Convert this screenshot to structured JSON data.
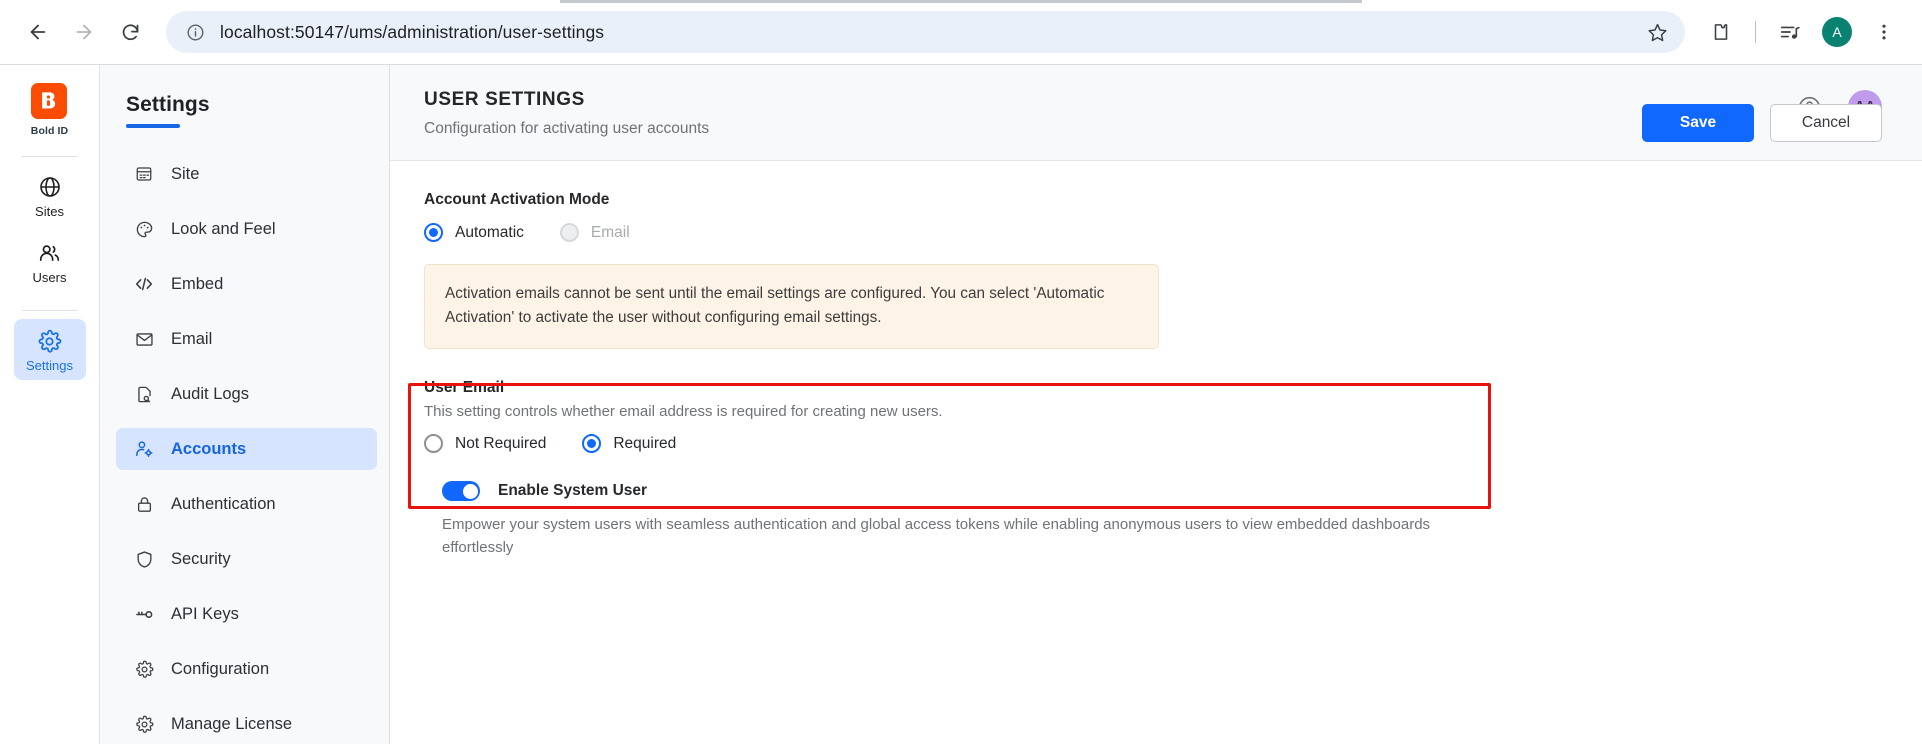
{
  "browser": {
    "url": "localhost:50147/ums/administration/user-settings",
    "back_label": "Back",
    "forward_label": "Forward",
    "reload_label": "Reload",
    "site_info_label": "View site information",
    "bookmark_label": "Bookmark this tab",
    "extensions_label": "Extensions",
    "media_label": "Media control",
    "profile_initial": "A",
    "menu_label": "Customize and control Chrome"
  },
  "rail": {
    "brand_label": "Bold ID",
    "items": [
      {
        "label": "Sites",
        "icon": "globe-icon",
        "active": false
      },
      {
        "label": "Users",
        "icon": "people-icon",
        "active": false
      },
      {
        "label": "Settings",
        "icon": "gear-icon",
        "active": true
      }
    ]
  },
  "nav": {
    "title": "Settings",
    "items": [
      {
        "label": "Site",
        "icon": "site-icon"
      },
      {
        "label": "Look and Feel",
        "icon": "palette-icon"
      },
      {
        "label": "Embed",
        "icon": "code-icon"
      },
      {
        "label": "Email",
        "icon": "envelope-icon"
      },
      {
        "label": "Audit Logs",
        "icon": "document-search-icon"
      },
      {
        "label": "Accounts",
        "icon": "user-gear-icon"
      },
      {
        "label": "Authentication",
        "icon": "lock-icon"
      },
      {
        "label": "Security",
        "icon": "shield-icon"
      },
      {
        "label": "API Keys",
        "icon": "key-icon"
      },
      {
        "label": "Configuration",
        "icon": "gear-icon"
      },
      {
        "label": "Manage License",
        "icon": "gear-icon"
      }
    ],
    "active_index": 5
  },
  "header": {
    "title": "USER SETTINGS",
    "subtitle": "Configuration for activating user accounts",
    "help_label": "Help",
    "avatar_initials": "AA",
    "save_label": "Save",
    "cancel_label": "Cancel"
  },
  "form": {
    "activation": {
      "label": "Account Activation Mode",
      "options": [
        {
          "label": "Automatic",
          "checked": true,
          "disabled": false
        },
        {
          "label": "Email",
          "checked": false,
          "disabled": true
        }
      ]
    },
    "warning": "Activation emails cannot be sent until the email settings are configured. You can select 'Automatic Activation' to activate the user without configuring email settings.",
    "user_email": {
      "label": "User Email",
      "description": "This setting controls whether email address is required for creating new users.",
      "options": [
        {
          "label": "Not Required",
          "checked": false
        },
        {
          "label": "Required",
          "checked": true
        }
      ]
    },
    "system_user": {
      "label": "Enable System User",
      "enabled": true,
      "description": "Empower your system users with seamless authentication and global access tokens while enabling anonymous users to view embedded dashboards effortlessly"
    }
  },
  "annotation": {
    "highlight_color": "#e8130f"
  }
}
